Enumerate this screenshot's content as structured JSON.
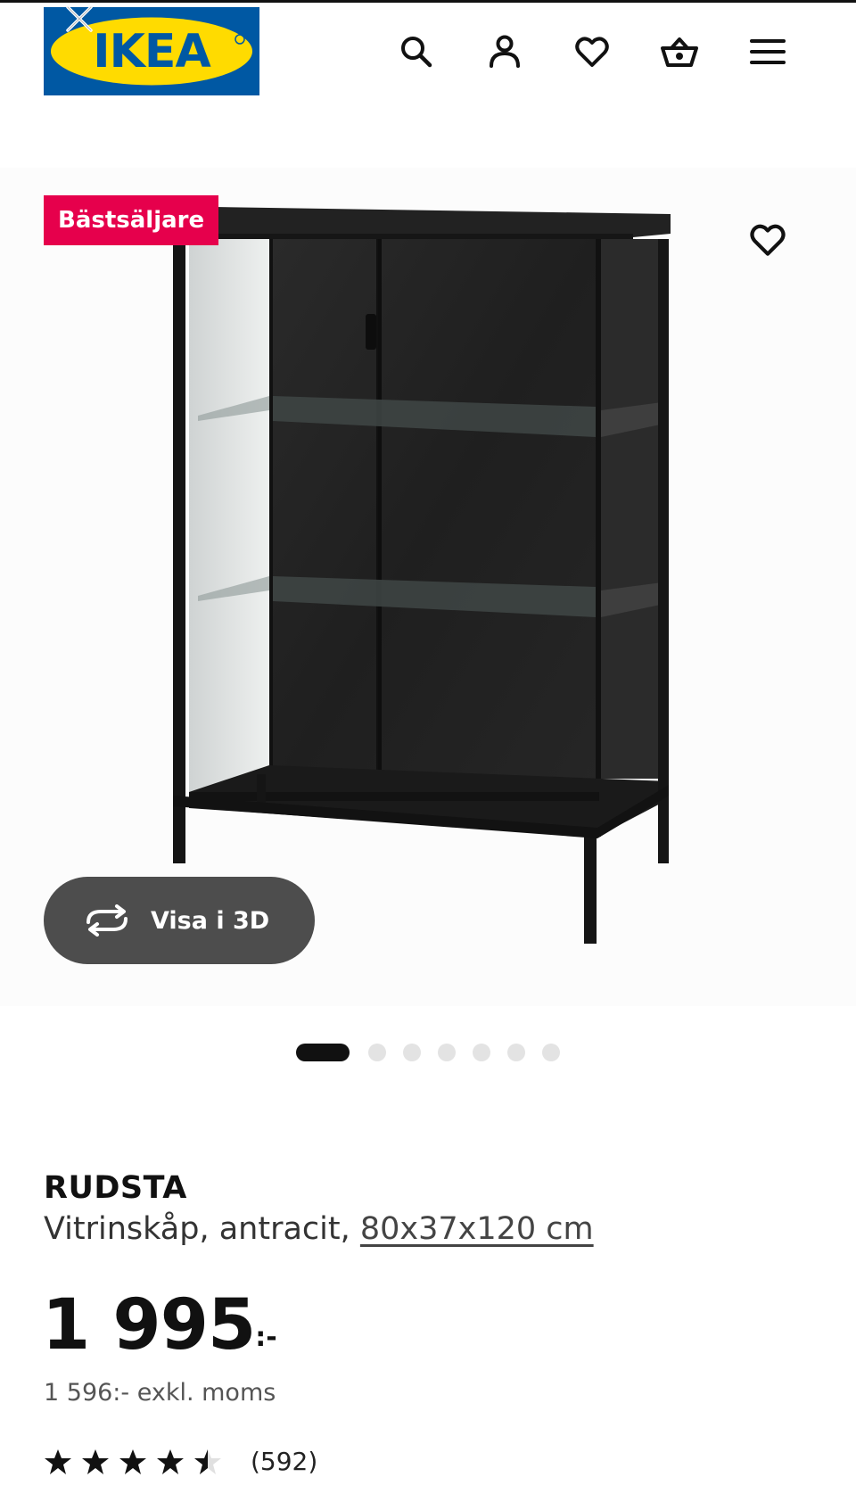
{
  "header": {
    "logo_text": "IKEA",
    "icons": [
      "search-icon",
      "user-icon",
      "heart-icon",
      "basket-icon",
      "menu-icon"
    ]
  },
  "colors": {
    "ikea_blue": "#0058a3",
    "ikea_yellow": "#ffdb00",
    "badge_pink": "#e6004c",
    "view3d_bg": "#4d4d4d"
  },
  "gallery": {
    "badge": "Bästsäljare",
    "view3d_label": "Visa i 3D",
    "image_count": 7,
    "active_index": 0
  },
  "product": {
    "name": "RUDSTA",
    "description": "Vitrinskåp, antracit,",
    "dimensions": "80x37x120 cm",
    "price": "1 995",
    "price_suffix": ":-",
    "price_excl_vat": "1 596:- exkl. moms",
    "rating_value": 4.5,
    "rating_max": 5,
    "review_count": "(592)"
  }
}
